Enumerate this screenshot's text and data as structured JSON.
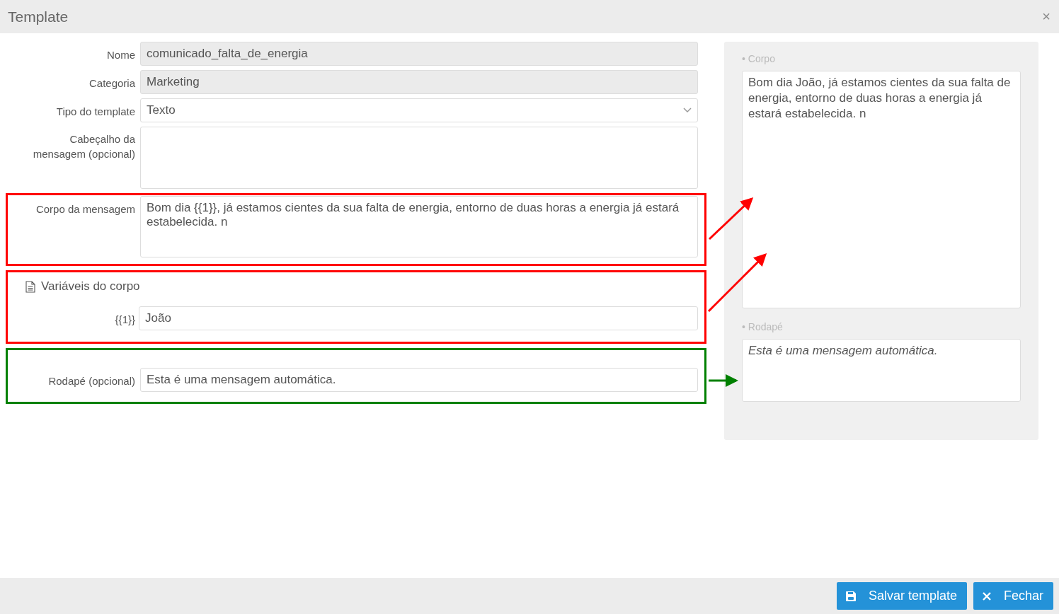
{
  "dialog": {
    "title": "Template",
    "close": "×"
  },
  "fields": [
    {
      "label": "Nome",
      "value": "comunicado_falta_de_energia",
      "kind": "readonly"
    },
    {
      "label": "Categoria",
      "value": "Marketing",
      "kind": "readonly"
    },
    {
      "label": "Tipo do template",
      "value": "Texto",
      "kind": "select"
    },
    {
      "label": "Cabeçalho da mensagem (opcional)",
      "kind": "textarea"
    }
  ],
  "body": {
    "label": "Corpo da mensagem",
    "value": "Bom dia {{1}}, já estamos cientes da sua falta de energia, entorno de duas horas a energia já estará estabelecida. n"
  },
  "variables": {
    "title": "Variáveis do corpo",
    "items": [
      {
        "label": "{{1}}",
        "value": "João"
      }
    ]
  },
  "footer_field": {
    "label": "Rodapé (opcional)",
    "value": "Esta é uma mensagem automática."
  },
  "preview": {
    "body_label": "• Corpo",
    "body": "Bom dia João, já estamos cientes da sua falta de energia, entorno de duas horas a energia já estará estabelecida. n",
    "footer_label": "• Rodapé",
    "footer": "Esta é uma mensagem automática."
  },
  "buttons": [
    {
      "label": "Salvar template",
      "kind": "save"
    },
    {
      "label": "Fechar",
      "kind": "close"
    }
  ]
}
